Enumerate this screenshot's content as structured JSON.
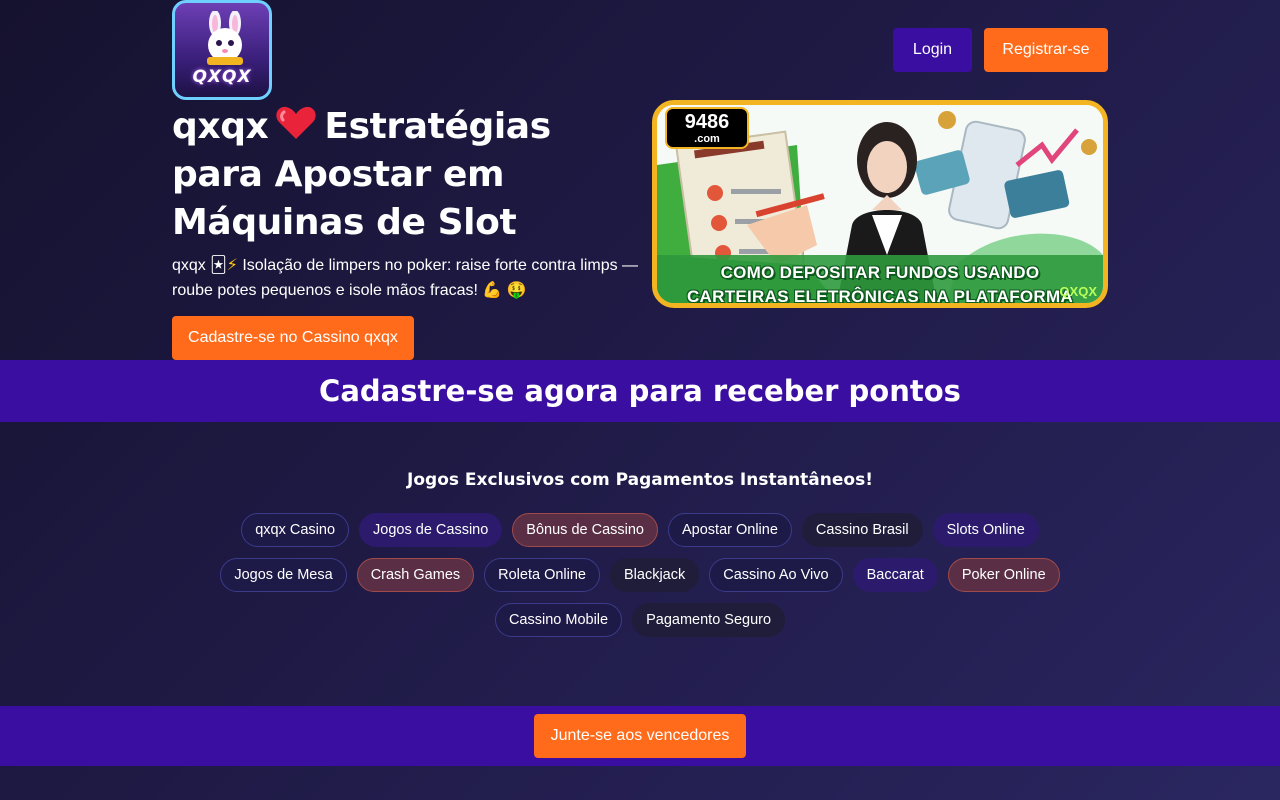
{
  "header": {
    "logo_text": "QXQX",
    "login_label": "Login",
    "register_label": "Registrar-se"
  },
  "hero": {
    "title_part1": "qxqx",
    "title_part2": "Estratégias para Apostar em Máquinas de Slot",
    "subtitle_part1": "qxqx",
    "subtitle_part2": "Isolação de limpers no poker: raise forte contra limps — roube potes pequenos e isole mãos fracas!",
    "cta_label": "Cadastre-se no Cassino qxqx"
  },
  "banner": {
    "brand_number": "9486",
    "brand_domain": ".com",
    "caption_line1": "COMO DEPOSITAR FUNDOS USANDO",
    "caption_line2": "CARTEIRAS ELETRÔNICAS NA PLATAFORMA",
    "watermark": "QXQX"
  },
  "promo": {
    "heading": "Cadastre-se agora para receber pontos"
  },
  "games": {
    "title": "Jogos Exclusivos com Pagamentos Instantâneos!",
    "tags": [
      "qxqx Casino",
      "Jogos de Cassino",
      "Bônus de Cassino",
      "Apostar Online",
      "Cassino Brasil",
      "Slots Online",
      "Jogos de Mesa",
      "Crash Games",
      "Roleta Online",
      "Blackjack",
      "Cassino Ao Vivo",
      "Baccarat",
      "Poker Online",
      "Cassino Mobile",
      "Pagamento Seguro"
    ]
  },
  "footer_cta": {
    "label": "Junte-se aos vencedores"
  },
  "colors": {
    "accent_orange": "#ff6b1a",
    "accent_purple": "#3a0ea0",
    "banner_border": "#f2b521"
  }
}
